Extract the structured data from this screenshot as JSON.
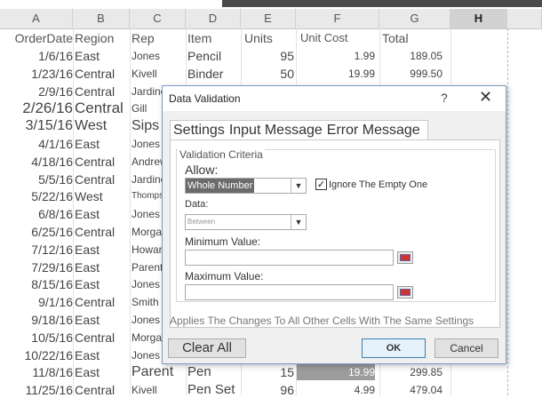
{
  "columns": [
    "A",
    "B",
    "C",
    "D",
    "E",
    "F",
    "G",
    "H"
  ],
  "selected_column": "H",
  "headers": {
    "date": "OrderDate",
    "region": "Region",
    "rep": "Rep",
    "item": "Item",
    "units": "Units",
    "cost": "Unit Cost",
    "total": "Total"
  },
  "rows": [
    {
      "date": "1/6/16",
      "region": "East",
      "rep": "Jones",
      "item": "Pencil",
      "units": "95",
      "cost": "1.99",
      "total": "189.05"
    },
    {
      "date": "1/23/16",
      "region": "Central",
      "rep": "Kivell",
      "item": "Binder",
      "units": "50",
      "cost": "19.99",
      "total": "999.50"
    },
    {
      "date": "2/9/16",
      "region": "Central",
      "rep": "Jardine",
      "item": "",
      "units": "",
      "cost": "",
      "total": ""
    },
    {
      "date": "2/26/16",
      "region": "Central",
      "rep": "Gill",
      "item": "",
      "units": "",
      "cost": "",
      "total": ""
    },
    {
      "date": "3/15/16",
      "region": "West",
      "rep": "Sips",
      "item": "",
      "units": "",
      "cost": "",
      "total": ""
    },
    {
      "date": "4/1/16",
      "region": "East",
      "rep": "Jones",
      "item": "",
      "units": "",
      "cost": "",
      "total": ""
    },
    {
      "date": "4/18/16",
      "region": "Central",
      "rep": "Andrews",
      "item": "",
      "units": "",
      "cost": "",
      "total": ""
    },
    {
      "date": "5/5/16",
      "region": "Central",
      "rep": "Jardine",
      "item": "",
      "units": "",
      "cost": "",
      "total": ""
    },
    {
      "date": "5/22/16",
      "region": "West",
      "rep": "Thompson",
      "item": "",
      "units": "",
      "cost": "",
      "total": ""
    },
    {
      "date": "6/8/16",
      "region": "East",
      "rep": "Jones",
      "item": "",
      "units": "",
      "cost": "",
      "total": ""
    },
    {
      "date": "6/25/16",
      "region": "Central",
      "rep": "Morgan",
      "item": "",
      "units": "",
      "cost": "",
      "total": ""
    },
    {
      "date": "7/12/16",
      "region": "East",
      "rep": "Howard",
      "item": "",
      "units": "",
      "cost": "",
      "total": ""
    },
    {
      "date": "7/29/16",
      "region": "East",
      "rep": "Parent",
      "item": "",
      "units": "",
      "cost": "",
      "total": ""
    },
    {
      "date": "8/15/16",
      "region": "East",
      "rep": "Jones",
      "item": "",
      "units": "",
      "cost": "",
      "total": ""
    },
    {
      "date": "9/1/16",
      "region": "Central",
      "rep": "Smith",
      "item": "",
      "units": "",
      "cost": "",
      "total": ""
    },
    {
      "date": "9/18/16",
      "region": "East",
      "rep": "Jones",
      "item": "",
      "units": "",
      "cost": "",
      "total": ""
    },
    {
      "date": "10/5/16",
      "region": "Central",
      "rep": "Morgan",
      "item": "",
      "units": "",
      "cost": "",
      "total": ""
    },
    {
      "date": "10/22/16",
      "region": "East",
      "rep": "Jones",
      "item": "",
      "units": "",
      "cost": "",
      "total": ""
    },
    {
      "date": "11/8/16",
      "region": "East",
      "rep": "Parent",
      "item": "Pen",
      "units": "15",
      "cost": "19.99",
      "total": "299.85"
    },
    {
      "date": "11/25/16",
      "region": "Central",
      "rep": "Kivell",
      "item": "Pen Set",
      "units": "96",
      "cost": "4.99",
      "total": "479.04"
    }
  ],
  "dialog": {
    "title": "Data Validation",
    "help": "?",
    "close": "✕",
    "tabs": [
      "Settings",
      "Input Message",
      "Error Message"
    ],
    "group_title": "Validation Criteria",
    "allow_label": "Allow:",
    "allow_value": "Whole Number",
    "ignore_label": "Ignore The Empty One",
    "ignore_checked": "✓",
    "data_label": "Data:",
    "data_value": "Between",
    "min_label": "Minimum Value:",
    "min_value": "",
    "max_label": "Maximum Value:",
    "max_value": "",
    "apply_text": "Applies The Changes To All Other Cells With The Same Settings",
    "clear_label": "Clear All",
    "ok_label": "OK",
    "cancel_label": "Cancel"
  }
}
